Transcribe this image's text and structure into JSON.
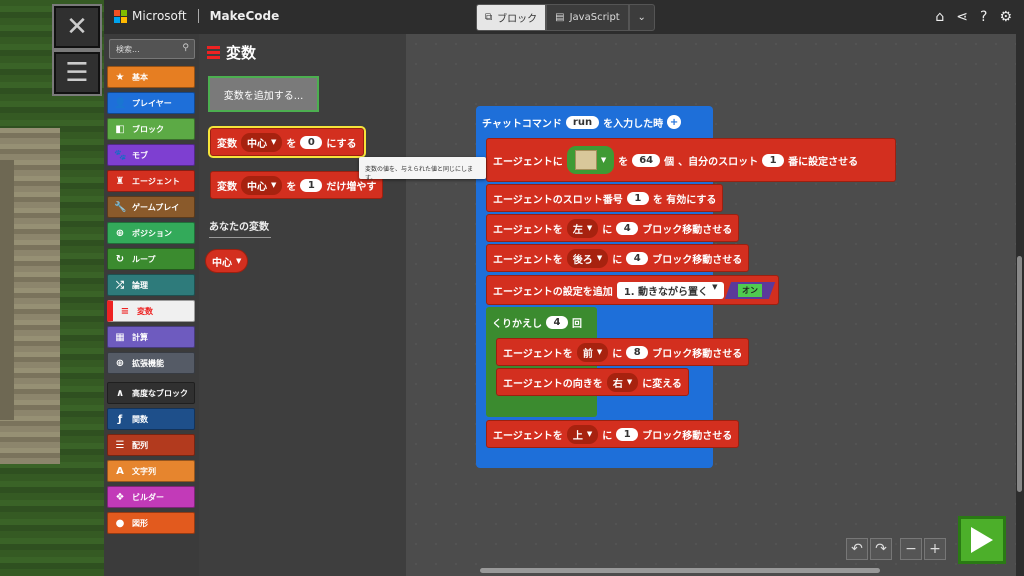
{
  "topbar": {
    "brand": "Microsoft",
    "product": "MakeCode",
    "tab_blocks": "ブロック",
    "tab_js": "JavaScript"
  },
  "toolbox": {
    "search_placeholder": "検索...",
    "categories": [
      {
        "label": "基本",
        "color": "#e67e22",
        "icon": "star-icon"
      },
      {
        "label": "プレイヤー",
        "color": "#1e6fd9",
        "icon": "person-icon"
      },
      {
        "label": "ブロック",
        "color": "#5caa45",
        "icon": "cube-icon"
      },
      {
        "label": "モブ",
        "color": "#7e3fd1",
        "icon": "paw-icon"
      },
      {
        "label": "エージェント",
        "color": "#d32f1f",
        "icon": "agent-icon"
      },
      {
        "label": "ゲームプレイ",
        "color": "#8a5a2b",
        "icon": "wrench-icon"
      },
      {
        "label": "ポジション",
        "color": "#33aa5a",
        "icon": "crosshair-icon"
      },
      {
        "label": "ループ",
        "color": "#3b8b2f",
        "icon": "loop-icon"
      },
      {
        "label": "論理",
        "color": "#2e7b7b",
        "icon": "shuffle-icon"
      },
      {
        "label": "変数",
        "color": "#e22d2d",
        "icon": "list-icon"
      },
      {
        "label": "計算",
        "color": "#6e5bbf",
        "icon": "calculator-icon"
      },
      {
        "label": "拡張機能",
        "color": "#555b66",
        "icon": "plus-circle-icon"
      },
      {
        "label": "高度なブロック",
        "color": "#303030",
        "icon": "chevron-up-icon"
      },
      {
        "label": "関数",
        "color": "#1e4f8a",
        "icon": "function-icon"
      },
      {
        "label": "配列",
        "color": "#b23a1e",
        "icon": "array-icon"
      },
      {
        "label": "文字列",
        "color": "#e6852e",
        "icon": "text-icon"
      },
      {
        "label": "ビルダー",
        "color": "#c23ab8",
        "icon": "builder-icon"
      },
      {
        "label": "図形",
        "color": "#e25a1e",
        "icon": "shape-icon"
      }
    ]
  },
  "flyout": {
    "title": "変数",
    "add_var": "変数を追加する...",
    "set_block": {
      "kw": "変数",
      "var": "中心",
      "mid": "を",
      "val": "0",
      "end": "にする"
    },
    "change_block": {
      "kw": "変数",
      "var": "中心",
      "mid": "を",
      "val": "1",
      "end": "だけ増やす"
    },
    "your_vars": "あなたの変数",
    "var_chip": "中心",
    "tooltip": "変数の値を、与えられた値と同じにします。"
  },
  "workspace": {
    "event": {
      "text1": "チャットコマンド",
      "cmd": "run",
      "text2": "を入力した時"
    },
    "b1": {
      "pre": "エージェントに",
      "mid": "を",
      "count": "64",
      "unit": "個",
      "mid2": "、自分のスロット",
      "slot": "1",
      "post": "番に設定させる"
    },
    "b2": {
      "pre": "エージェントのスロット番号",
      "slot": "1",
      "post": "を 有効にする"
    },
    "b3": {
      "pre": "エージェントを",
      "dir": "左",
      "mid": "に",
      "num": "4",
      "post": "ブロック移動させる"
    },
    "b4": {
      "pre": "エージェントを",
      "dir": "後ろ",
      "mid": "に",
      "num": "4",
      "post": "ブロック移動させる"
    },
    "b5": {
      "pre": "エージェントの設定を追加",
      "opt": "1. 動きながら置く",
      "toggle": "オン"
    },
    "loop": {
      "pre": "くりかえし",
      "num": "4",
      "post": "回"
    },
    "b6": {
      "pre": "エージェントを",
      "dir": "前",
      "mid": "に",
      "num": "8",
      "post": "ブロック移動させる"
    },
    "b7": {
      "pre": "エージェントの向きを",
      "dir": "右",
      "post": "に変える"
    },
    "b8": {
      "pre": "エージェントを",
      "dir": "上",
      "mid": "に",
      "num": "1",
      "post": "ブロック移動させる"
    }
  }
}
